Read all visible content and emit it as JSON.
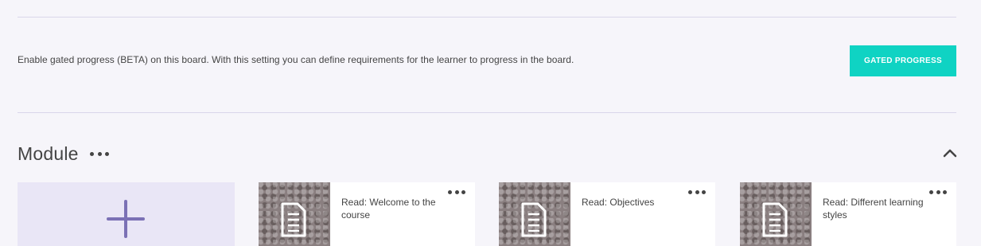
{
  "gated": {
    "description": "Enable gated progress (BETA) on this board. With this setting you can define requirements for the learner to progress in the board.",
    "button_label": "GATED PROGRESS"
  },
  "module": {
    "title": "Module",
    "menu_icon": "more-dots-icon",
    "collapse_icon": "chevron-up-icon",
    "add_icon": "plus-icon",
    "cards": [
      {
        "title": "Read: Welcome to the course",
        "icon": "document-icon"
      },
      {
        "title": "Read: Objectives",
        "icon": "document-icon"
      },
      {
        "title": "Read: Different learning styles",
        "icon": "document-icon"
      }
    ]
  },
  "colors": {
    "accent": "#0fd3c3",
    "background": "#f6f5fa",
    "add_card_bg": "#e9e6f6",
    "plus": "#7b71b5"
  }
}
